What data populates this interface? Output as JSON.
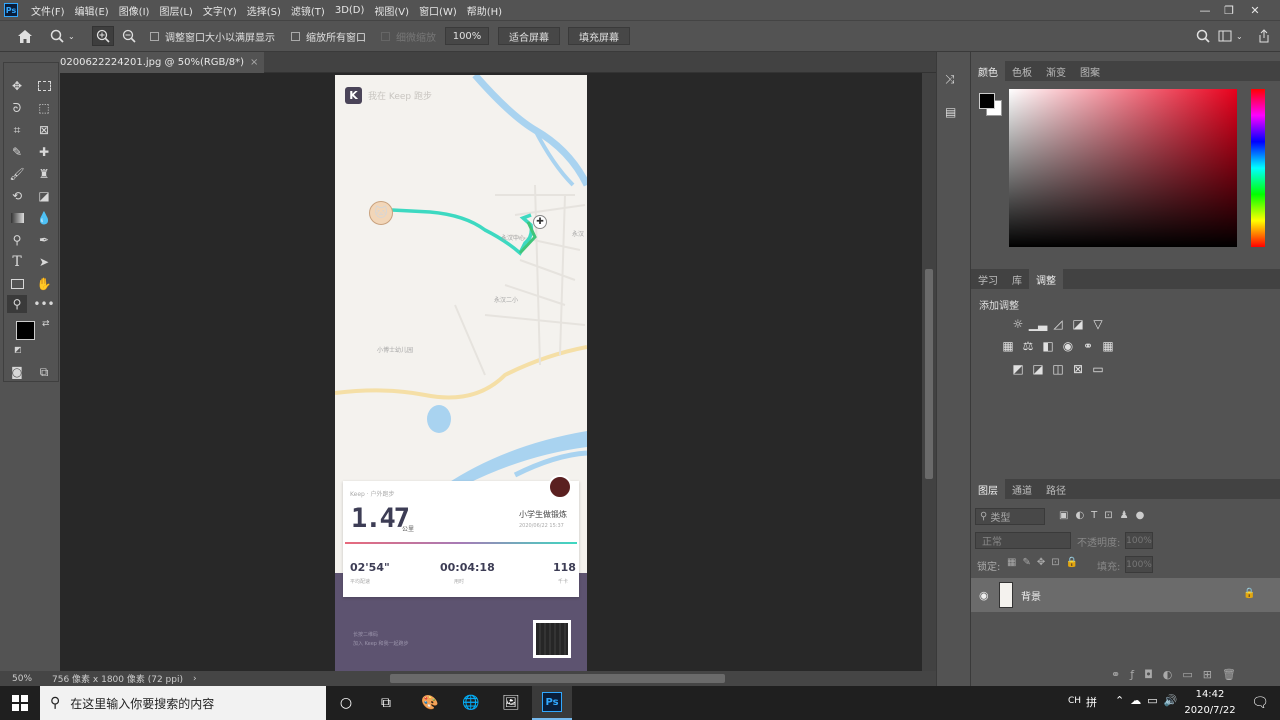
{
  "app": {
    "logo": "Ps"
  },
  "menu": [
    "文件(F)",
    "编辑(E)",
    "图像(I)",
    "图层(L)",
    "文字(Y)",
    "选择(S)",
    "滤镜(T)",
    "3D(D)",
    "视图(V)",
    "窗口(W)",
    "帮助(H)"
  ],
  "window_controls": {
    "minimize": "—",
    "restore": "❐",
    "close": "✕"
  },
  "options": {
    "resize_windows": "调整窗口大小以满屏显示",
    "zoom_all": "缩放所有窗口",
    "scrubby_zoom": "细微缩放",
    "zoom_value": "100%",
    "fit_screen": "适合屏幕",
    "fill_screen": "填充屏幕"
  },
  "document": {
    "tab_title": "0200622224201.jpg @ 50%(RGB/8*)",
    "close": "×"
  },
  "status": {
    "zoom": "50%",
    "info": "756 像素 x 1800 像素 (72 ppi)"
  },
  "image": {
    "header": "我在 Keep 跑步",
    "map_labels": [
      "永汉中心",
      "永汉二小",
      "小博士幼儿园",
      "永汉"
    ],
    "card": {
      "source": "Keep · 户外跑步",
      "distance": "1.47",
      "distance_unit": "公里",
      "user": "小学生做锻炼",
      "datetime": "2020/06/22 15:37",
      "stats": [
        {
          "value": "02'54\"",
          "label": "平均配速"
        },
        {
          "value": "00:04:18",
          "label": "用时"
        },
        {
          "value": "118",
          "label": "千卡"
        }
      ]
    },
    "footer": {
      "line1": "长按二维码",
      "line2": "加入 Keep 和我一起跑步"
    }
  },
  "panels": {
    "color_tabs": [
      "颜色",
      "色板",
      "渐变",
      "图案"
    ],
    "adj_tabs": [
      "学习",
      "库",
      "调整"
    ],
    "adj_title": "添加调整",
    "layer_tabs": [
      "图层",
      "通道",
      "路径"
    ],
    "layer_filter": "类型",
    "blend_mode": "正常",
    "opacity_label": "不透明度:",
    "opacity_value": "100%",
    "lock_label": "锁定:",
    "fill_label": "填充:",
    "fill_value": "100%",
    "layer_name": "背景"
  },
  "taskbar": {
    "search_placeholder": "在这里输入你要搜索的内容",
    "ime": "CH",
    "ime_mode": "拼",
    "time": "14:42",
    "date": "2020/7/22"
  },
  "colors": {
    "accent_route": "#3dd9c1",
    "footer_bg": "#5d5370",
    "ps_blue": "#31a8ff"
  }
}
